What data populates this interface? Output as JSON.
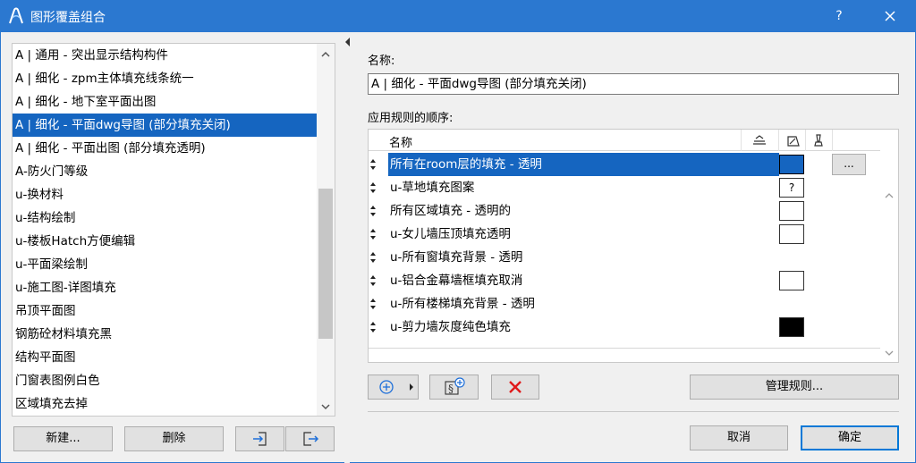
{
  "window": {
    "title": "图形覆盖组合",
    "help_label": "?"
  },
  "left_list": {
    "items": [
      {
        "label": "A | 通用 - 突出显示结构构件",
        "selected": false
      },
      {
        "label": "A | 细化 - zpm主体填充线条统一",
        "selected": false
      },
      {
        "label": "A | 细化 - 地下室平面出图",
        "selected": false
      },
      {
        "label": "A | 细化 - 平面dwg导图 (部分填充关闭)",
        "selected": true
      },
      {
        "label": "A | 细化 - 平面出图 (部分填充透明)",
        "selected": false
      },
      {
        "label": "A-防火门等级",
        "selected": false
      },
      {
        "label": "u-换材料",
        "selected": false
      },
      {
        "label": "u-结构绘制",
        "selected": false
      },
      {
        "label": "u-楼板Hatch方便编辑",
        "selected": false
      },
      {
        "label": "u-平面梁绘制",
        "selected": false
      },
      {
        "label": "u-施工图-详图填充",
        "selected": false
      },
      {
        "label": "吊顶平面图",
        "selected": false
      },
      {
        "label": "钢筋砼材料填充黑",
        "selected": false
      },
      {
        "label": "结构平面图",
        "selected": false
      },
      {
        "label": "门窗表图例白色",
        "selected": false
      },
      {
        "label": "区域填充去掉",
        "selected": false
      }
    ]
  },
  "left_buttons": {
    "new_label": "新建...",
    "delete_label": "删除"
  },
  "form": {
    "name_label": "名称:",
    "name_value": "A | 细化 - 平面dwg导图 (部分填充关闭)",
    "order_label": "应用规则的顺序:"
  },
  "rules": {
    "header_name": "名称",
    "rows": [
      {
        "name": "所有在room层的填充 - 透明",
        "swatch": "blue",
        "selected": true,
        "more": "..."
      },
      {
        "name": "u-草地填充图案",
        "swatch": "question",
        "swatch_text": "?",
        "selected": false
      },
      {
        "name": "所有区域填充 - 透明的",
        "swatch": "white",
        "selected": false
      },
      {
        "name": "u-女儿墙压顶填充透明",
        "swatch": "white",
        "selected": false
      },
      {
        "name": "u-所有窗填充背景 - 透明",
        "swatch": "none",
        "selected": false
      },
      {
        "name": "u-铝合金幕墙框填充取消",
        "swatch": "white",
        "selected": false
      },
      {
        "name": "u-所有楼梯填充背景 - 透明",
        "swatch": "none",
        "selected": false
      },
      {
        "name": "u-剪力墙灰度纯色填充",
        "swatch": "black",
        "selected": false
      }
    ]
  },
  "rule_buttons": {
    "manage_label": "管理规则..."
  },
  "dialog_buttons": {
    "cancel_label": "取消",
    "ok_label": "确定"
  },
  "colors": {
    "titlebar": "#2b78d0",
    "selection": "#1565c0",
    "delete_x": "#e0191a",
    "add_icon": "#1e6fd9"
  }
}
